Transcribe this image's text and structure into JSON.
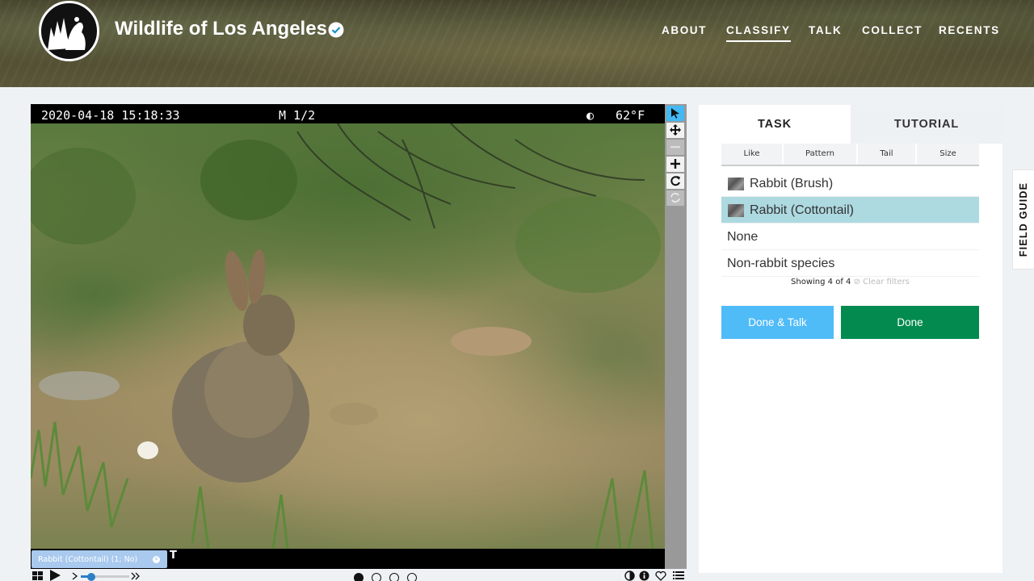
{
  "header": {
    "title": "Wildlife of Los Angeles",
    "nav": [
      "ABOUT",
      "CLASSIFY",
      "TALK",
      "COLLECT",
      "RECENTS"
    ],
    "active_nav": "CLASSIFY"
  },
  "viewer": {
    "timestamp": "2020-04-18 15:18:33",
    "frame": "M 1/2",
    "moon": "◐",
    "temperature": "62°F",
    "bottom_char": "T",
    "subject_tag": "Rabbit (Cottontail) (1; No)",
    "frame_dots": 4,
    "active_frame": 1
  },
  "panel": {
    "tabs": [
      "TASK",
      "TUTORIAL"
    ],
    "filters": [
      "Like",
      "Pattern",
      "Tail",
      "Size"
    ],
    "choices": [
      {
        "label": "Rabbit (Brush)",
        "thumb": true,
        "selected": false
      },
      {
        "label": "Rabbit (Cottontail)",
        "thumb": true,
        "selected": true
      },
      {
        "label": "None",
        "thumb": false,
        "selected": false
      },
      {
        "label": "Non-rabbit species",
        "thumb": false,
        "selected": false
      }
    ],
    "showing": "Showing 4 of 4",
    "clear_filters": "Clear filters",
    "buttons": {
      "done_talk": "Done & Talk",
      "done": "Done"
    }
  },
  "field_guide": "FIELD GUIDE",
  "colors": {
    "accent_blue": "#4fbbf7",
    "done_green": "#038b4f",
    "selected_bg": "#add9e0"
  }
}
